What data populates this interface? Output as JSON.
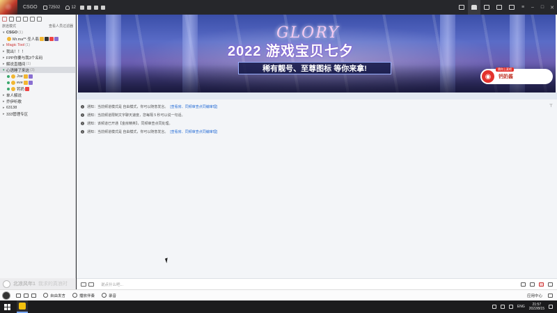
{
  "topbar": {
    "room_name": "CSGO",
    "viewers": "72502",
    "users": "12"
  },
  "sidebar": {
    "head_left": "旅途模式",
    "head_right": "查看人员过滤器",
    "items": [
      {
        "label": "CSGO",
        "count": "(1)",
        "kind": "group-open"
      },
      {
        "label": "Mr.ma**·圣人翡",
        "kind": "user"
      },
      {
        "label": "Magic Tool",
        "count": "(1)",
        "kind": "red"
      },
      {
        "label": "我出！！！",
        "kind": "group"
      },
      {
        "label": "FPP你要与我3个名码",
        "kind": "group"
      },
      {
        "label": "解说直播间",
        "count": "(1)",
        "kind": "group"
      },
      {
        "label": "心语睡了来这",
        "count": "(3)",
        "kind": "selected"
      },
      {
        "label": "Joe",
        "kind": "user"
      },
      {
        "label": "eve",
        "kind": "user"
      },
      {
        "label": "钙奶",
        "kind": "user"
      },
      {
        "label": "单人解说",
        "kind": "group"
      },
      {
        "label": "乔伊听歌",
        "kind": "group"
      },
      {
        "label": "63138",
        "kind": "group"
      },
      {
        "label": "333管理专区",
        "kind": "group"
      }
    ],
    "bottom_name": "北凉风年1",
    "bottom_msg": "我求的真浪时"
  },
  "banner": {
    "glory": "GLORY",
    "title": "2022 游戏宝贝七夕",
    "subtitle": "稀有靓号、至尊图标 等你来拿!",
    "promo_tag": "猜你上麦吧",
    "promo_text": "钙奶酱"
  },
  "chat": {
    "lines": [
      {
        "text": "通知：当前频道模式是 自由模式，你可以随意发言。",
        "link": "[查看房、同频审查点同编审理]"
      },
      {
        "text": "通知：当前频道限制文字聊天速度，您每隔 5 秒可以说一句话。",
        "link": ""
      },
      {
        "text": "通知：该频道已开通【金房精英】，同频审查点同处理。",
        "link": ""
      },
      {
        "text": "通知：当前频道模式是 自由模式，你可以随意发言。",
        "link": "[查看房、同频审查点同编审理]"
      }
    ],
    "pin": "⊤"
  },
  "input": {
    "placeholder": "说点什么吧..."
  },
  "dock": {
    "item1": "自由发言",
    "item2": "播放伴奏",
    "item3": "录音",
    "right_label": "应用中心"
  },
  "taskbar": {
    "lang": "ENG",
    "time": "21:57",
    "date": "2022/8/15"
  }
}
